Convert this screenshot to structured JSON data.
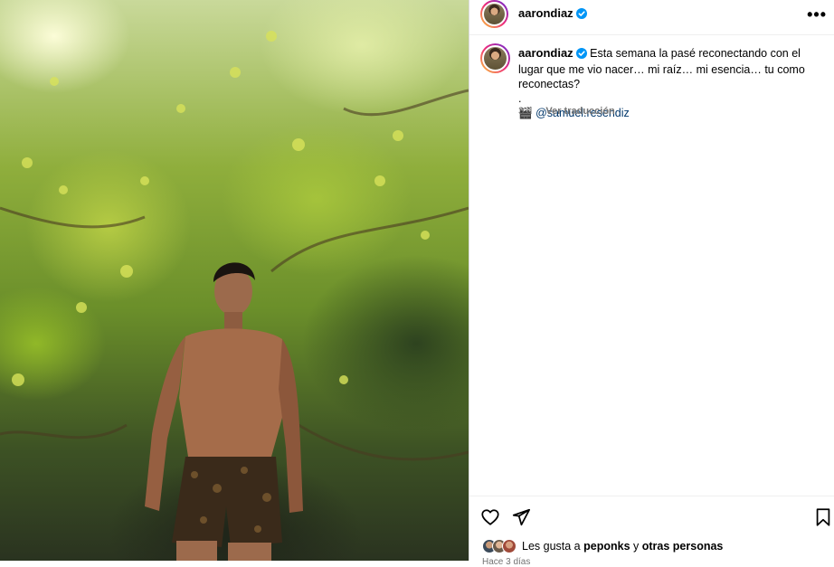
{
  "post": {
    "username": "aarondiaz",
    "more_label": "•••",
    "caption_line1": "Esta semana la pasé reconectando con el lugar que me vio nacer… mi raíz… mi esencia… tu como reconectas?",
    "caption_dot": ".",
    "camera_emoji": "🎬",
    "mention": "@samuel.resendiz",
    "time_ago": "3 d",
    "translate_label": "Ver traducción",
    "likes_prefix": "Les gusta a",
    "likes_user": "peponks",
    "likes_join": "y",
    "likes_others": "otras personas",
    "footer_time": "Hace 3 días"
  },
  "colors": {
    "verified": "#0095f6",
    "mention": "#00376b",
    "muted": "#737373",
    "border": "#dbdbdb"
  },
  "icons": {
    "like": "heart-icon",
    "share": "paper-plane-icon",
    "save": "bookmark-icon",
    "more": "more-options-icon"
  }
}
